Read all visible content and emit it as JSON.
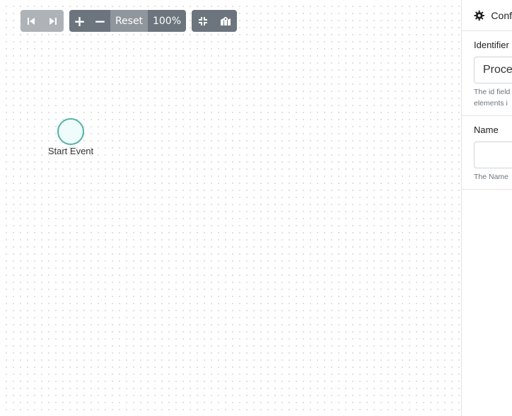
{
  "toolbar": {
    "undo_icon": "skip-back-icon",
    "redo_icon": "skip-forward-icon",
    "zoom_in_label": "+",
    "zoom_out_label": "−",
    "reset_label": "Reset",
    "zoom_level": "100%",
    "fit_icon": "compress-icon",
    "minimap_icon": "map-icon"
  },
  "diagram": {
    "start_event_label": "Start Event"
  },
  "panel": {
    "header_title": "Conf",
    "header_icon": "gear-icon",
    "identifier": {
      "label": "Identifier",
      "value": "Proce",
      "help_line1": "The id field",
      "help_line2": "elements i"
    },
    "name": {
      "label": "Name",
      "value": "",
      "help": "The Name"
    }
  },
  "colors": {
    "toolbar_button": "#6c757d",
    "toolbar_disabled": "#aeb3b8",
    "start_event_stroke": "#55b3a3",
    "start_event_fill": "#eefcfc"
  }
}
